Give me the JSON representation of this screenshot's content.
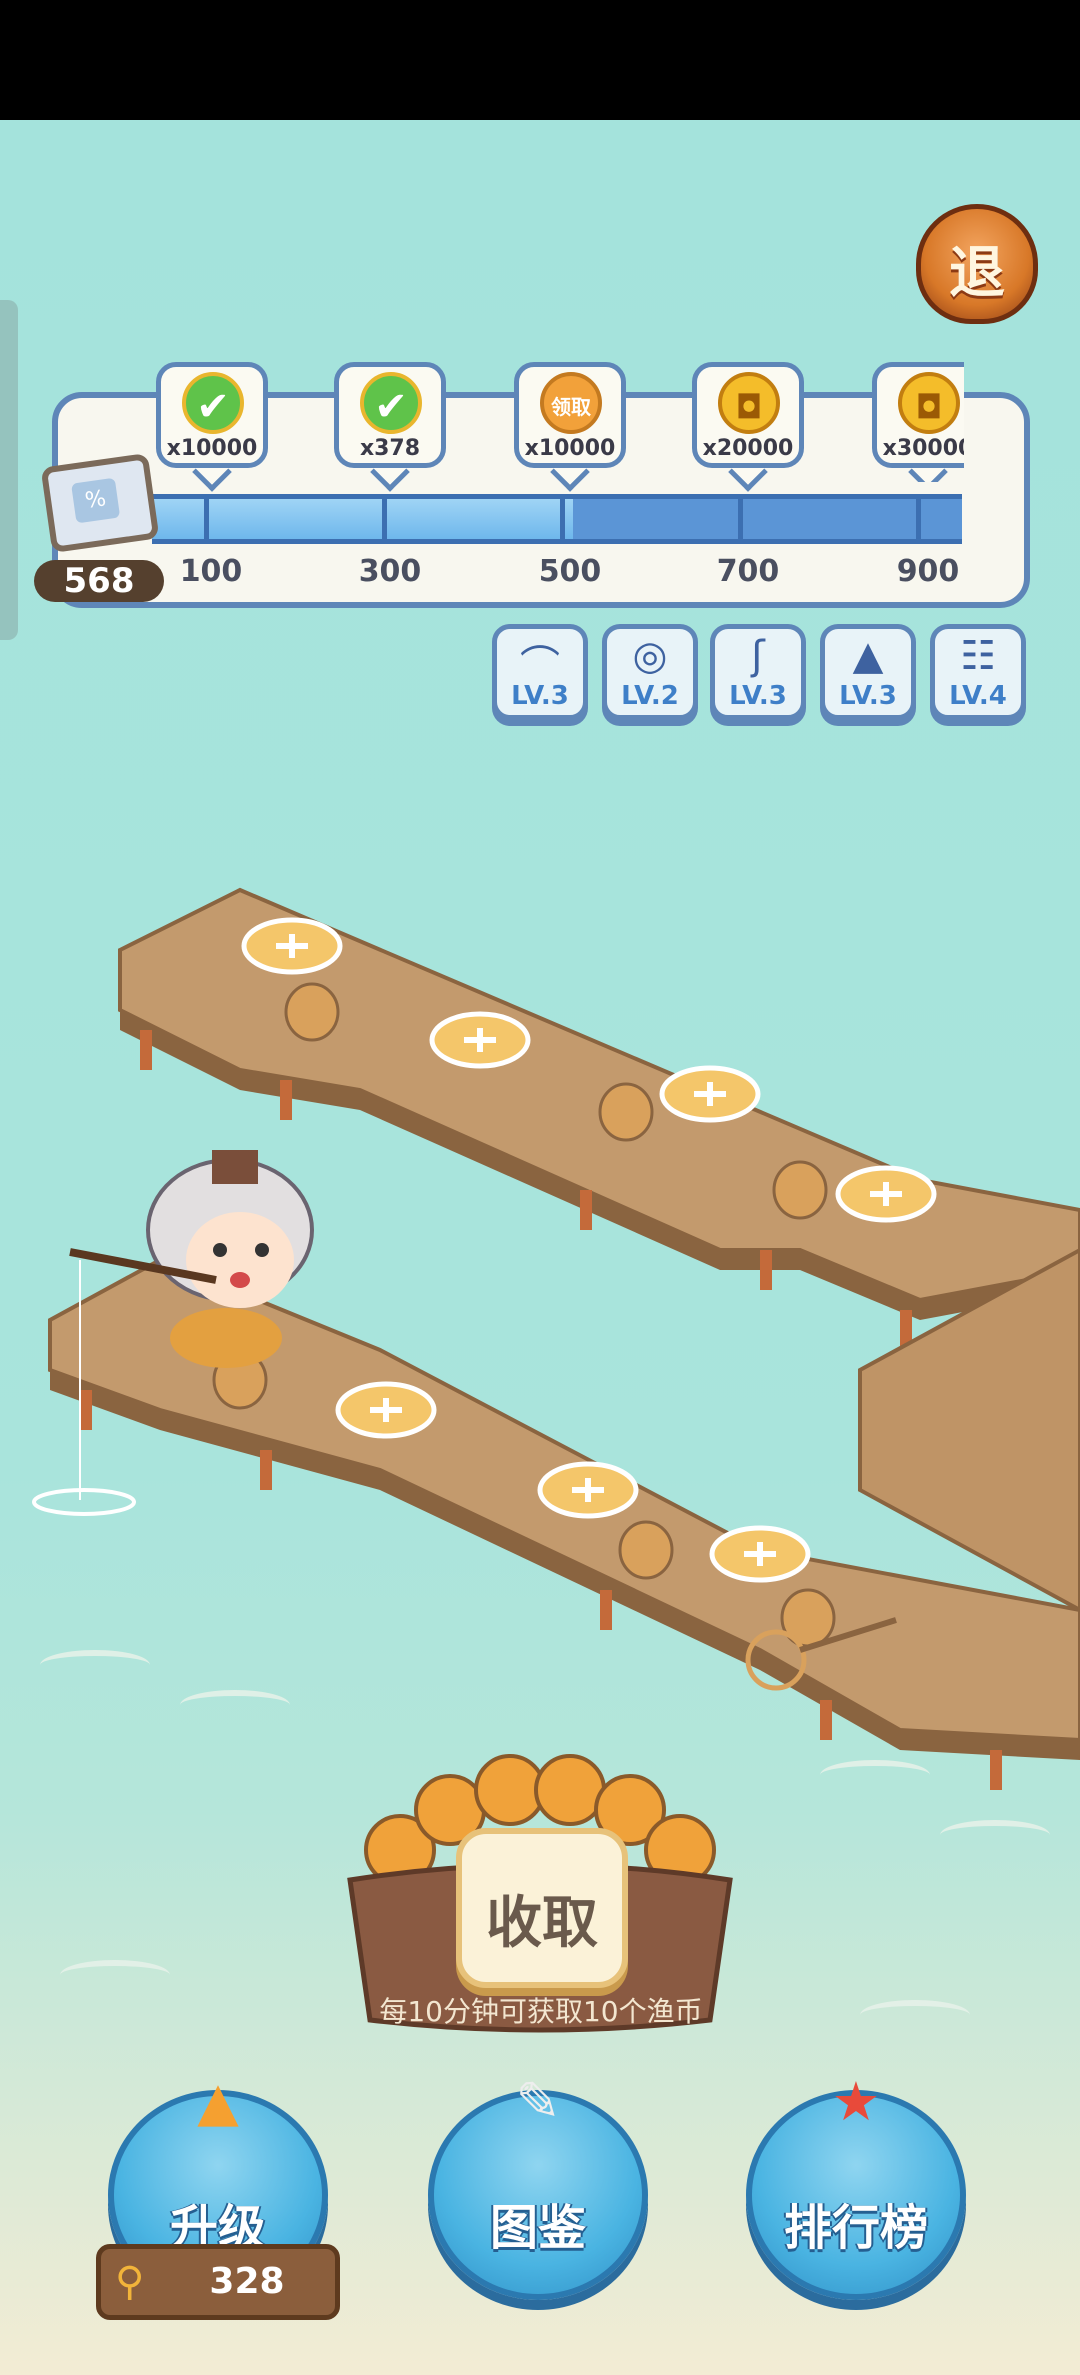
{
  "header": {
    "exit_label": "退"
  },
  "progress": {
    "score": "568",
    "fill_fraction": 0.52,
    "milestones": [
      {
        "amount": "x10000",
        "icon": "check-icon",
        "state": "done",
        "glyph": "✔"
      },
      {
        "amount": "x378",
        "icon": "check-icon",
        "state": "done",
        "glyph": "✔"
      },
      {
        "amount": "x10000",
        "icon": "claim-coin-icon",
        "state": "claim",
        "glyph": "领取"
      },
      {
        "amount": "x20000",
        "icon": "coin-icon",
        "state": "coin",
        "glyph": "◘"
      },
      {
        "amount": "x30000",
        "icon": "coin-icon",
        "state": "coin",
        "glyph": "◘"
      }
    ],
    "ticks": [
      "100",
      "300",
      "500",
      "700",
      "900"
    ]
  },
  "gear": [
    {
      "name": "rod",
      "icon": "fishing-rod-icon",
      "glyph": "⌒",
      "level": "LV.3"
    },
    {
      "name": "reel",
      "icon": "reel-icon",
      "glyph": "◎",
      "level": "LV.2"
    },
    {
      "name": "hook",
      "icon": "hook-icon",
      "glyph": "ʃ",
      "level": "LV.3"
    },
    {
      "name": "hat",
      "icon": "hat-icon",
      "glyph": "▲",
      "level": "LV.3"
    },
    {
      "name": "stool",
      "icon": "stool-icon",
      "glyph": "☷",
      "level": "LV.4"
    }
  ],
  "collect": {
    "label": "收取",
    "hint": "每10分钟可获取10个渔币"
  },
  "bottom_nav": {
    "upgrade_label": "升级",
    "catalog_label": "图鉴",
    "leaderboard_label": "排行榜",
    "fish_coins": "328"
  },
  "colors": {
    "sea": "#a9e3dc",
    "panel_border": "#5e86b8",
    "progress_blue": "#5b95d6",
    "dock_wood": "#b98c60"
  }
}
